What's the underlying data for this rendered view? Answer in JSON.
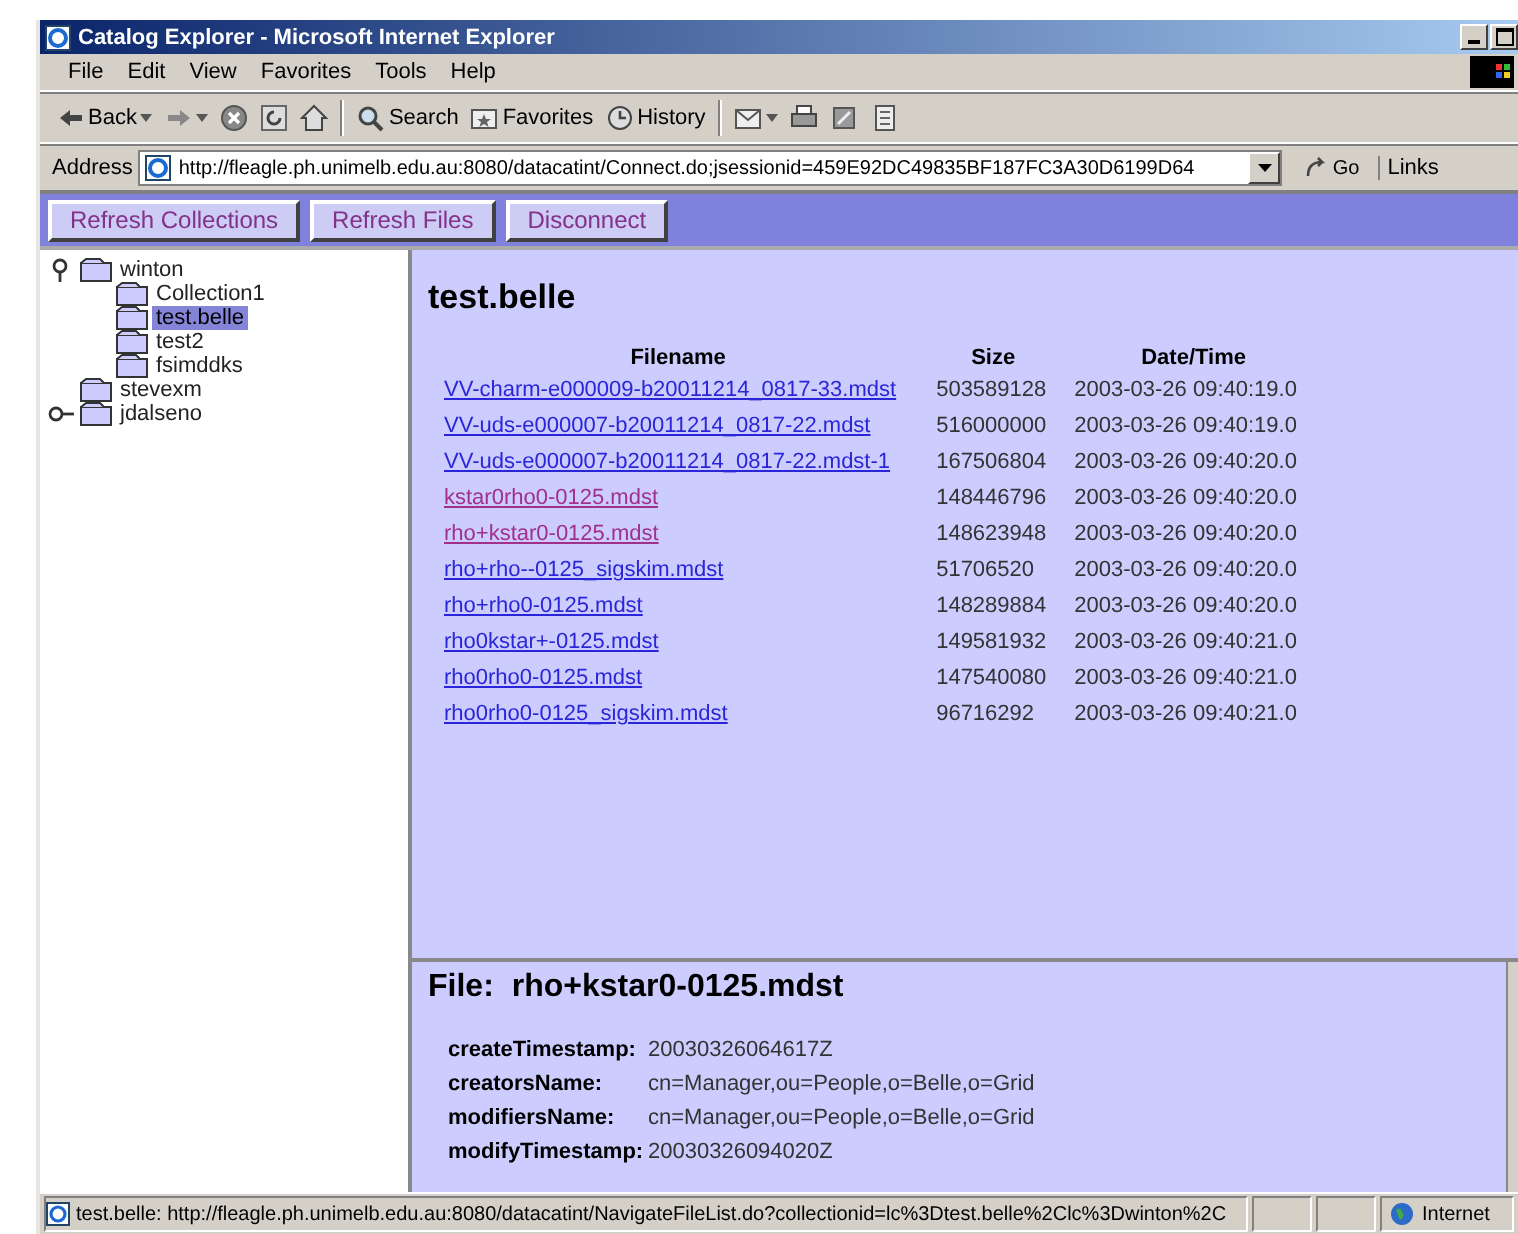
{
  "window": {
    "title": "Catalog Explorer - Microsoft Internet Explorer"
  },
  "menu_bar": [
    "File",
    "Edit",
    "View",
    "Favorites",
    "Tools",
    "Help"
  ],
  "toolbar": [
    {
      "kind": "back",
      "label": "Back"
    },
    {
      "kind": "forward"
    },
    {
      "kind": "stop"
    },
    {
      "kind": "refresh"
    },
    {
      "kind": "home"
    },
    {
      "kind": "search",
      "label": "Search"
    },
    {
      "kind": "favorites",
      "label": "Favorites"
    },
    {
      "kind": "history",
      "label": "History"
    },
    {
      "kind": "mail"
    },
    {
      "kind": "print"
    },
    {
      "kind": "edit"
    },
    {
      "kind": "discuss"
    }
  ],
  "address_bar": {
    "label": "Address",
    "url": "http://fleagle.ph.unimelb.edu.au:8080/datacatint/Connect.do;jsessionid=459E92DC49835BF187FC3A30D6199D64",
    "go": "Go",
    "links": "Links"
  },
  "page_buttons": [
    "Refresh Collections",
    "Refresh Files",
    "Disconnect"
  ],
  "tree": [
    {
      "label": "winton",
      "expanded": true,
      "selected": false,
      "children": [
        {
          "label": "Collection1",
          "selected": false
        },
        {
          "label": "test.belle",
          "selected": true
        },
        {
          "label": "test2",
          "selected": false
        },
        {
          "label": "fsimddks",
          "selected": false
        }
      ]
    },
    {
      "label": "stevexm",
      "selected": false
    },
    {
      "label": "jdalseno",
      "expanded": false,
      "selected": false
    }
  ],
  "file_list": {
    "title": "test.belle",
    "columns": [
      "Filename",
      "Size",
      "Date/Time"
    ],
    "rows": [
      {
        "filename": "VV-charm-e000009-b20011214_0817-33.mdst",
        "size": "503589128",
        "datetime": "2003-03-26 09:40:19.0",
        "visited": false
      },
      {
        "filename": "VV-uds-e000007-b20011214_0817-22.mdst",
        "size": "516000000",
        "datetime": "2003-03-26 09:40:19.0",
        "visited": false
      },
      {
        "filename": "VV-uds-e000007-b20011214_0817-22.mdst-1",
        "size": "167506804",
        "datetime": "2003-03-26 09:40:20.0",
        "visited": false
      },
      {
        "filename": "kstar0rho0-0125.mdst",
        "size": "148446796",
        "datetime": "2003-03-26 09:40:20.0",
        "visited": true
      },
      {
        "filename": "rho+kstar0-0125.mdst",
        "size": "148623948",
        "datetime": "2003-03-26 09:40:20.0",
        "visited": true
      },
      {
        "filename": "rho+rho--0125_sigskim.mdst",
        "size": "51706520",
        "datetime": "2003-03-26 09:40:20.0",
        "visited": false
      },
      {
        "filename": "rho+rho0-0125.mdst",
        "size": "148289884",
        "datetime": "2003-03-26 09:40:20.0",
        "visited": false
      },
      {
        "filename": "rho0kstar+-0125.mdst",
        "size": "149581932",
        "datetime": "2003-03-26 09:40:21.0",
        "visited": false
      },
      {
        "filename": "rho0rho0-0125.mdst",
        "size": "147540080",
        "datetime": "2003-03-26 09:40:21.0",
        "visited": false
      },
      {
        "filename": "rho0rho0-0125_sigskim.mdst",
        "size": "96716292",
        "datetime": "2003-03-26 09:40:21.0",
        "visited": false
      }
    ]
  },
  "file_detail": {
    "label": "File:",
    "name": "rho+kstar0-0125.mdst",
    "attributes": [
      {
        "name": "createTimestamp:",
        "value": "20030326064617Z"
      },
      {
        "name": "creatorsName:",
        "value": "cn=Manager,ou=People,o=Belle,o=Grid"
      },
      {
        "name": "modifiersName:",
        "value": "cn=Manager,ou=People,o=Belle,o=Grid"
      },
      {
        "name": "modifyTimestamp:",
        "value": "20030326094020Z"
      }
    ]
  },
  "status_bar": {
    "text": "test.belle:  http://fleagle.ph.unimelb.edu.au:8080/datacatint/NavigateFileList.do?collectionid=lc%3Dtest.belle%2Clc%3Dwinton%2C",
    "zone": "Internet"
  }
}
